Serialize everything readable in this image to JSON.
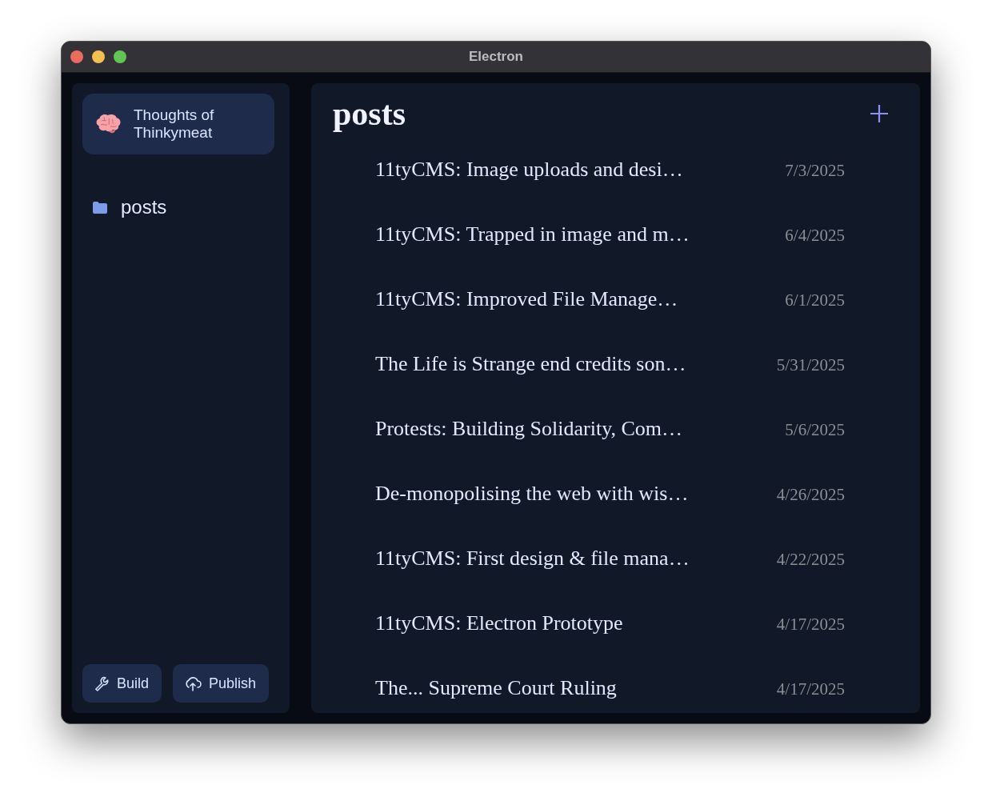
{
  "window": {
    "title": "Electron"
  },
  "sidebar": {
    "site": {
      "name": "Thoughts of Thinkymeat"
    },
    "folders": [
      {
        "label": "posts"
      }
    ],
    "buttons": [
      {
        "kind": "build",
        "label": "Build"
      },
      {
        "kind": "publish",
        "label": "Publish"
      }
    ]
  },
  "main": {
    "title": "posts",
    "posts": [
      {
        "title": "11tyCMS: Image uploads and desi…",
        "date": "7/3/2025"
      },
      {
        "title": "11tyCMS: Trapped in image and m…",
        "date": "6/4/2025"
      },
      {
        "title": "11tyCMS: Improved File Manage…",
        "date": "6/1/2025"
      },
      {
        "title": "The Life is Strange end credits son…",
        "date": "5/31/2025"
      },
      {
        "title": "Protests: Building Solidarity, Com…",
        "date": "5/6/2025"
      },
      {
        "title": "De-monopolising the web with wis…",
        "date": "4/26/2025"
      },
      {
        "title": "11tyCMS: First design & file mana…",
        "date": "4/22/2025"
      },
      {
        "title": "11tyCMS: Electron Prototype",
        "date": "4/17/2025"
      },
      {
        "title": "The... Supreme Court Ruling",
        "date": "4/17/2025"
      }
    ]
  }
}
